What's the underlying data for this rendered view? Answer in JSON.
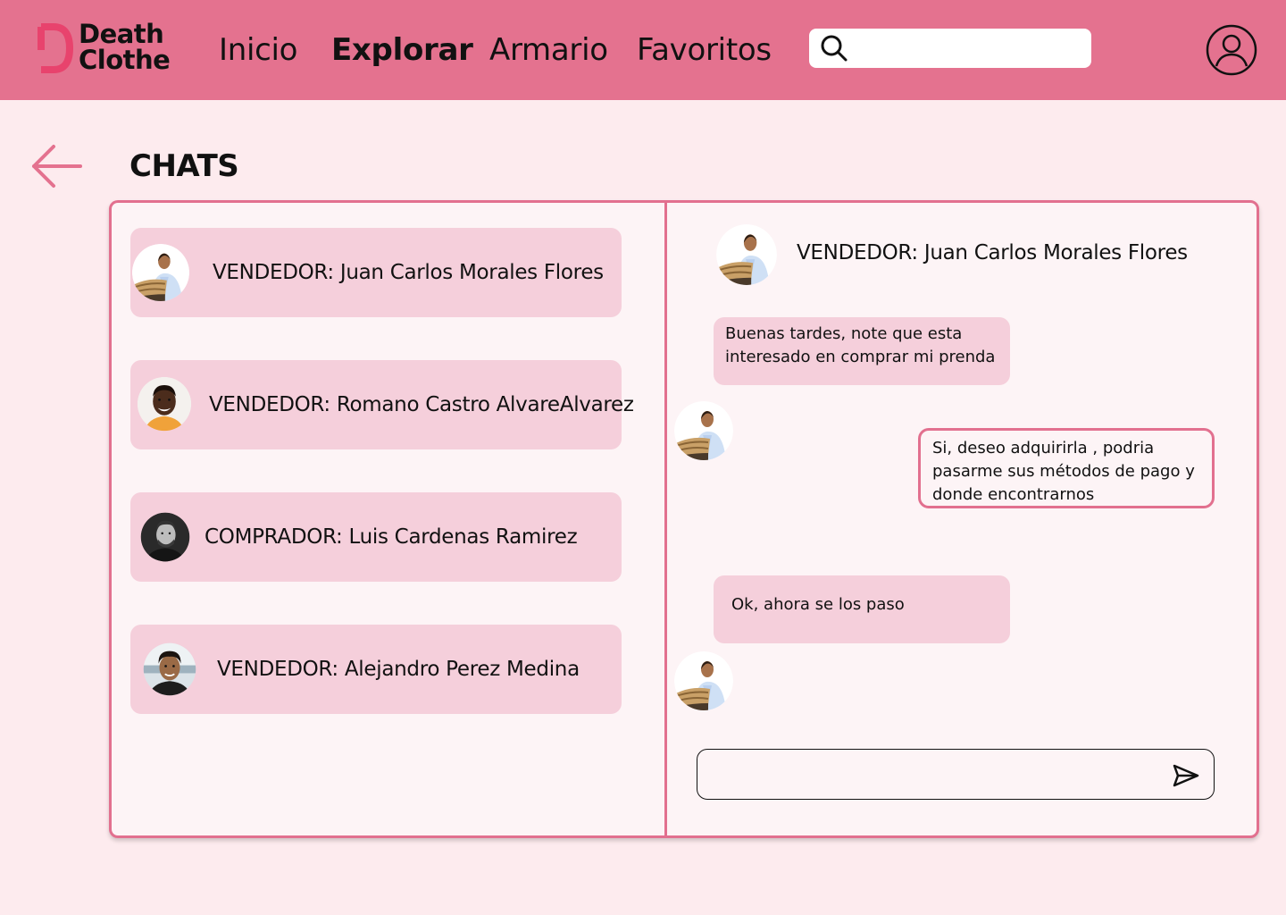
{
  "brand": {
    "line1": "Death",
    "line2": "Clothe",
    "accent": "#e8436d"
  },
  "nav": {
    "items": [
      {
        "label": "Inicio",
        "active": false
      },
      {
        "label": "Explorar",
        "active": true
      },
      {
        "label": "Armario",
        "active": false
      },
      {
        "label": "Favoritos",
        "active": false
      }
    ]
  },
  "search": {
    "placeholder": "",
    "value": "",
    "icon": "search-icon"
  },
  "header": {
    "user_icon": "user-icon",
    "background": "#e4728f"
  },
  "page": {
    "title": "CHATS",
    "back_icon": "arrow-left-icon"
  },
  "chats": [
    {
      "name": "VENDEDOR: Juan Carlos Morales Flores",
      "avatar": "avatar-juan"
    },
    {
      "name": "VENDEDOR: Romano Castro AlvareAlvarez",
      "avatar": "avatar-romano"
    },
    {
      "name": "COMPRADOR: Luis Cardenas Ramirez",
      "avatar": "avatar-luis"
    },
    {
      "name": "VENDEDOR: Alejandro Perez Medina",
      "avatar": "avatar-alejandro"
    }
  ],
  "conversation": {
    "contact_name": "VENDEDOR: Juan Carlos Morales Flores",
    "messages": [
      {
        "from": "incoming",
        "text": "Buenas tardes, note que esta interesado en comprar mi prenda"
      },
      {
        "from": "outgoing",
        "text": "Si, deseo adquirirla , podria pasarme sus métodos de pago y donde encontrarnos"
      },
      {
        "from": "incoming",
        "text": "Ok, ahora se los paso"
      }
    ],
    "composer": {
      "placeholder": "",
      "value": "",
      "send_icon": "send-icon"
    }
  },
  "colors": {
    "panel_border": "#e2708f",
    "bubble": "#f5cfdb",
    "page_bg": "#fdebee"
  }
}
